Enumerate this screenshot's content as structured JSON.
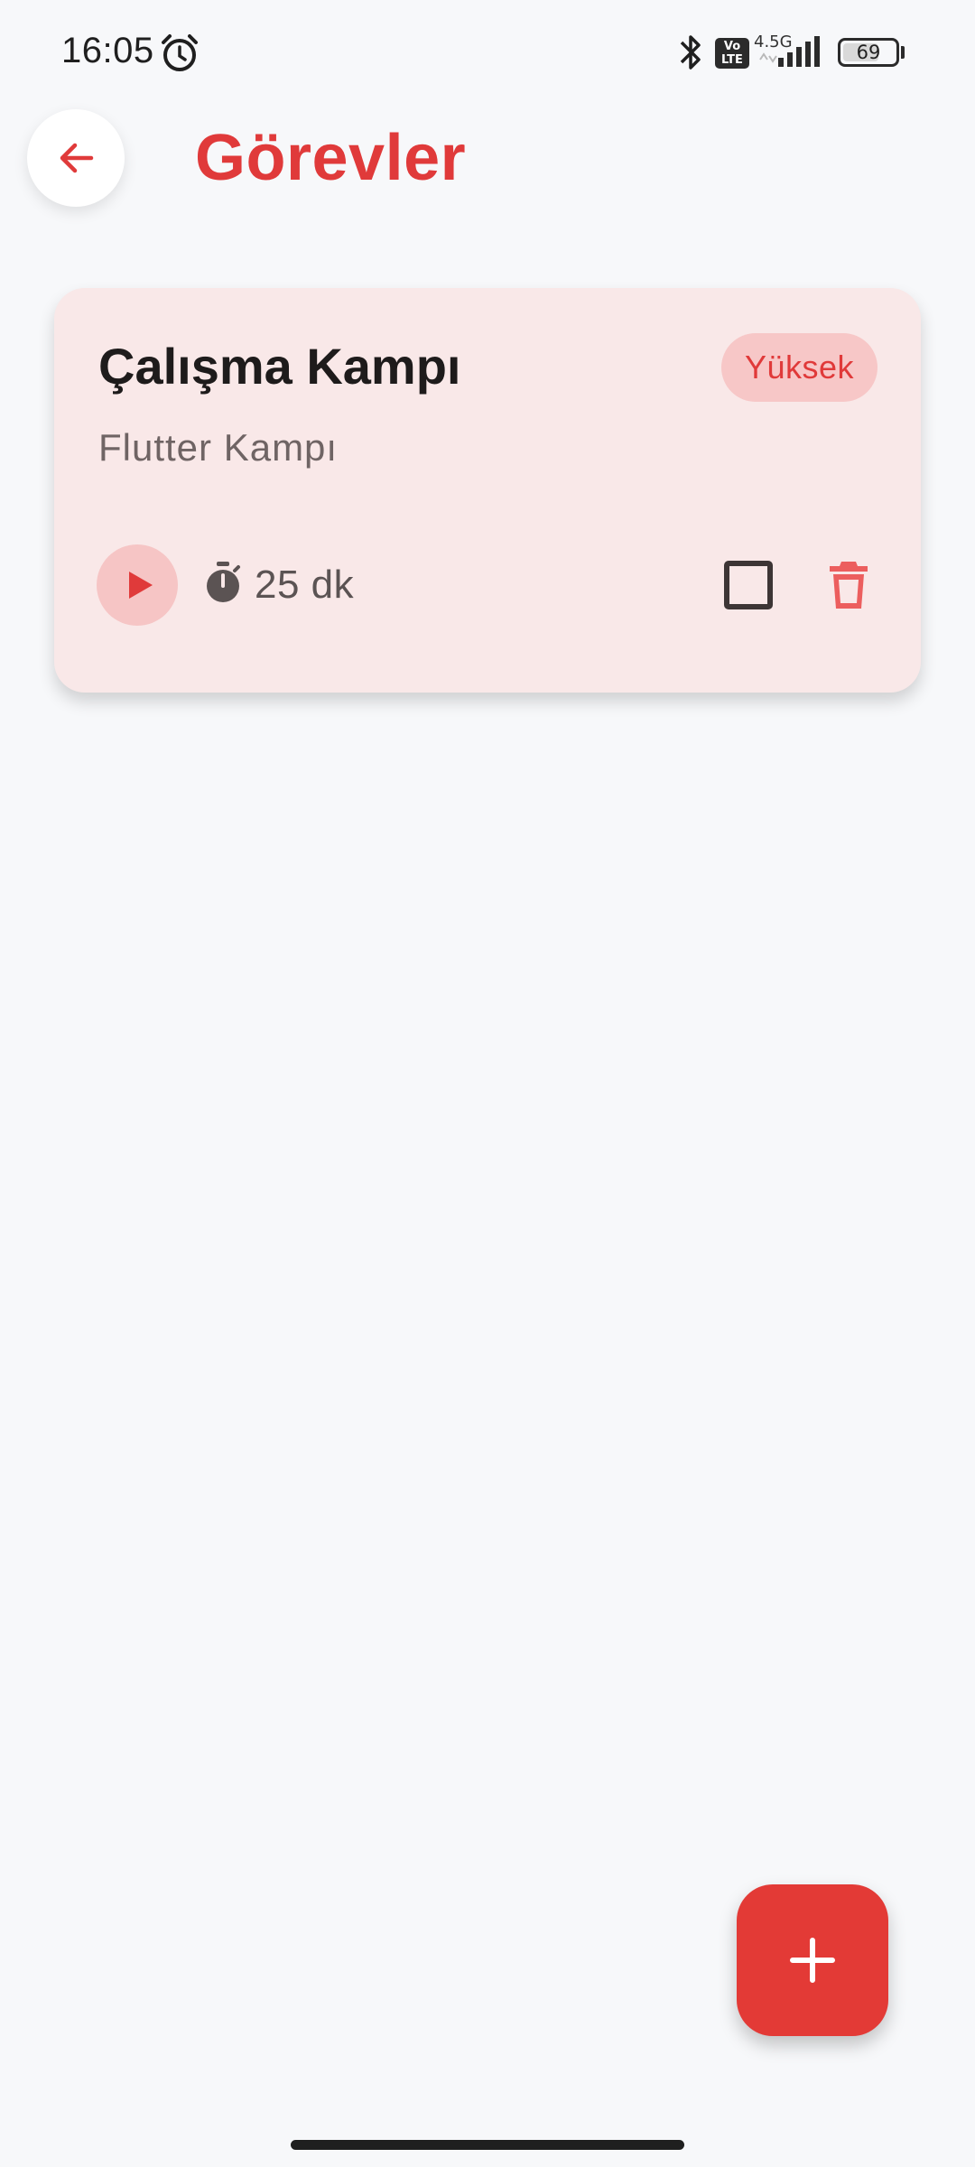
{
  "status_bar": {
    "time": "16:05",
    "network_type": "4.5G",
    "volte_label_line1": "Vo",
    "volte_label_line2": "LTE",
    "battery_level": "69",
    "battery_fraction": 0.69
  },
  "header": {
    "title": "Görevler",
    "back_icon": "arrow-left-icon"
  },
  "tasks": [
    {
      "title": "Çalışma Kampı",
      "priority": "Yüksek",
      "description": "Flutter Kampı",
      "duration": "25 dk",
      "completed": false
    }
  ],
  "fab": {
    "icon": "plus-icon"
  },
  "colors": {
    "accent": "#e03a3a",
    "card_background": "#f9e8e8",
    "badge_background": "#f7c7c7",
    "page_background": "#f7f8fa",
    "fab": "#e33a36"
  }
}
